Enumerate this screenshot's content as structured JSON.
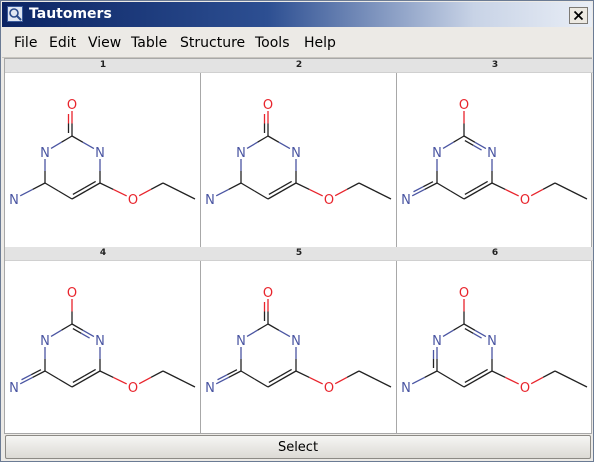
{
  "window": {
    "title": "Tautomers"
  },
  "menu": [
    "File",
    "Edit",
    "View",
    "Table",
    "Structure",
    "Tools",
    "Help"
  ],
  "cells": [
    {
      "label": "1",
      "variant": "a"
    },
    {
      "label": "2",
      "variant": "a"
    },
    {
      "label": "3",
      "variant": "b"
    },
    {
      "label": "4",
      "variant": "b"
    },
    {
      "label": "5",
      "variant": "c"
    },
    {
      "label": "6",
      "variant": "d"
    }
  ],
  "atoms": {
    "O": "O",
    "N": "N"
  },
  "footer": {
    "select_label": "Select"
  },
  "colors": {
    "oxygen": "#e8242c",
    "nitrogen": "#4a55a2",
    "bond": "#222222",
    "title_gradient_start": "#0b2463"
  }
}
